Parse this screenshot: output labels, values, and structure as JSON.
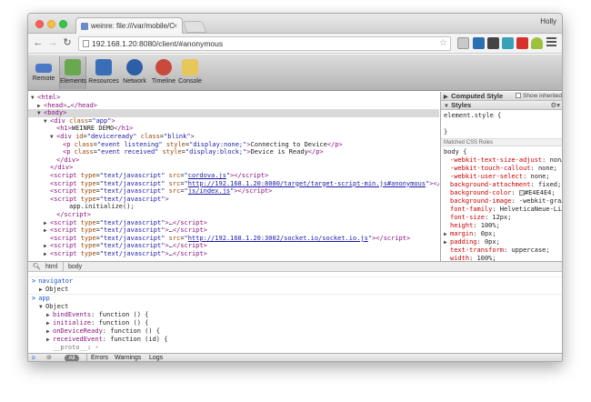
{
  "tab": {
    "title": "weinre: file:///var/mobile/C",
    "close": "×"
  },
  "profile": "Holly",
  "address": "192.168.1.20:8080/client/#anonymous",
  "devtools": {
    "tools": [
      {
        "label": "Remote",
        "color": "#4b79c8"
      },
      {
        "label": "Elements",
        "color": "#6aa84f"
      },
      {
        "label": "Resources",
        "color": "#e2a93b"
      },
      {
        "label": "Network",
        "color": "#3a6fb8"
      },
      {
        "label": "Timeline",
        "color": "#c94a3d"
      },
      {
        "label": "Console",
        "color": "#d88a2a"
      }
    ]
  },
  "elements": {
    "lines": [
      {
        "tri": "▼",
        "html": "<span class='tag'>&lt;html&gt;</span>",
        "indent": 0
      },
      {
        "tri": "▶",
        "html": "<span class='tag'>&lt;head&gt;</span>…<span class='tag'>&lt;/head&gt;</span>",
        "indent": 1
      },
      {
        "tri": "▼",
        "html": "<span class='tag'>&lt;body&gt;</span>",
        "indent": 1,
        "selected": true
      },
      {
        "tri": "▼",
        "html": "<span class='tag'>&lt;div </span><span class='attr'>class</span>=<span class='val'>\"app\"</span><span class='tag'>&gt;</span>",
        "indent": 2
      },
      {
        "tri": "",
        "html": "<span class='tag'>&lt;h1&gt;</span>WEINRE DEMO<span class='tag'>&lt;/h1&gt;</span>",
        "indent": 3
      },
      {
        "tri": "▼",
        "html": "<span class='tag'>&lt;div </span><span class='attr'>id</span>=<span class='val'>\"deviceready\"</span> <span class='attr'>class</span>=<span class='val'>\"blink\"</span><span class='tag'>&gt;</span>",
        "indent": 3
      },
      {
        "tri": "",
        "html": "<span class='tag'>&lt;p </span><span class='attr'>class</span>=<span class='val'>\"event listening\"</span> <span class='attr'>style</span>=<span class='val'>\"display:none;\"</span><span class='tag'>&gt;</span>Connecting to Device<span class='tag'>&lt;/p&gt;</span>",
        "indent": 4
      },
      {
        "tri": "",
        "html": "<span class='tag'>&lt;p </span><span class='attr'>class</span>=<span class='val'>\"event received\"</span> <span class='attr'>style</span>=<span class='val'>\"display:block;\"</span><span class='tag'>&gt;</span>Device is Ready<span class='tag'>&lt;/p&gt;</span>",
        "indent": 4
      },
      {
        "tri": "",
        "html": "<span class='tag'>&lt;/div&gt;</span>",
        "indent": 3
      },
      {
        "tri": "",
        "html": "<span class='tag'>&lt;/div&gt;</span>",
        "indent": 2
      },
      {
        "tri": "",
        "html": "<span class='tag'>&lt;script </span><span class='attr'>type</span>=<span class='val'>\"text/javascript\"</span> <span class='attr'>src</span>=<span class='val'>\"</span><span class='link'>cordova.js</span><span class='val'>\"</span><span class='tag'>&gt;&lt;/script&gt;</span>",
        "indent": 2
      },
      {
        "tri": "",
        "html": "<span class='tag'>&lt;script </span><span class='attr'>type</span>=<span class='val'>\"text/javascript\"</span> <span class='attr'>src</span>=<span class='val'>\"</span><span class='link'>http://192.168.1.20:8080/target/target-script-min.js#anonymous</span><span class='val'>\"</span><span class='tag'>&gt;&lt;/script&gt;</span>",
        "indent": 2
      },
      {
        "tri": "",
        "html": "<span class='tag'>&lt;script </span><span class='attr'>type</span>=<span class='val'>\"text/javascript\"</span> <span class='attr'>src</span>=<span class='val'>\"</span><span class='link'>js/index.js</span><span class='val'>\"</span><span class='tag'>&gt;&lt;/script&gt;</span>",
        "indent": 2
      },
      {
        "tri": "",
        "html": "<span class='tag'>&lt;script </span><span class='attr'>type</span>=<span class='val'>\"text/javascript\"</span><span class='tag'>&gt;</span>",
        "indent": 2
      },
      {
        "tri": "",
        "html": "<span class='txt'>app.initialize();</span>",
        "indent": 5
      },
      {
        "tri": "",
        "html": "<span class='tag'>&lt;/script&gt;</span>",
        "indent": 3
      },
      {
        "tri": "▶",
        "html": "<span class='tag'>&lt;script </span><span class='attr'>type</span>=<span class='val'>\"text/javascript\"</span><span class='tag'>&gt;</span>…<span class='tag'>&lt;/script&gt;</span>",
        "indent": 2
      },
      {
        "tri": "▶",
        "html": "<span class='tag'>&lt;script </span><span class='attr'>type</span>=<span class='val'>\"text/javascript\"</span><span class='tag'>&gt;</span>…<span class='tag'>&lt;/script&gt;</span>",
        "indent": 2
      },
      {
        "tri": "",
        "html": "<span class='tag'>&lt;script </span><span class='attr'>type</span>=<span class='val'>\"text/javascript\"</span> <span class='attr'>src</span>=<span class='val'>\"</span><span class='link'>http://192.168.1.20:3002/socket.io/socket.io.js</span><span class='val'>\"</span><span class='tag'>&gt;&lt;/script&gt;</span>",
        "indent": 2
      },
      {
        "tri": "▶",
        "html": "<span class='tag'>&lt;script </span><span class='attr'>type</span>=<span class='val'>\"text/javascript\"</span><span class='tag'>&gt;</span>…<span class='tag'>&lt;/script&gt;</span>",
        "indent": 2
      },
      {
        "tri": "▶",
        "html": "<span class='tag'>&lt;script </span><span class='attr'>type</span>=<span class='val'>\"text/javascript\"</span><span class='tag'>&gt;</span>…<span class='tag'>&lt;/script&gt;</span>",
        "indent": 2
      }
    ]
  },
  "sidebar": {
    "computed_title": "Computed Style",
    "show_inherited": "Show inherited",
    "styles_title": "Styles",
    "element_style": "element.style {",
    "close_brace": "}",
    "matched_title": "Matched CSS Rules",
    "body_selector": "body {",
    "props": [
      {
        "exp": false,
        "name": "-webkit-text-size-adjust",
        "value": "non…"
      },
      {
        "exp": false,
        "name": "-webkit-touch-callout",
        "value": "none;"
      },
      {
        "exp": false,
        "name": "-webkit-user-select",
        "value": "none;"
      },
      {
        "exp": false,
        "name": "background-attachment",
        "value": "fixed;"
      },
      {
        "exp": false,
        "name": "background-color",
        "value": "#E4E4E4;",
        "swatch": true
      },
      {
        "exp": false,
        "name": "background-image",
        "value": "-webkit-gra…"
      },
      {
        "exp": false,
        "name": "font-family",
        "value": "HelveticaNeue-Li…"
      },
      {
        "exp": false,
        "name": "font-size",
        "value": "12px;"
      },
      {
        "exp": false,
        "name": "height",
        "value": "100%;"
      },
      {
        "exp": true,
        "name": "margin",
        "value": "0px;"
      },
      {
        "exp": true,
        "name": "padding",
        "value": "0px;"
      },
      {
        "exp": false,
        "name": "text-transform",
        "value": "uppercase;"
      },
      {
        "exp": false,
        "name": "width",
        "value": "100%;"
      }
    ]
  },
  "breadcrumb": [
    "html",
    "body"
  ],
  "console": {
    "lines": [
      {
        "type": "input",
        "text": "navigator"
      },
      {
        "type": "obj",
        "tri": "▶",
        "text": "Object",
        "indent": 1
      },
      {
        "type": "input",
        "text": "app"
      },
      {
        "type": "obj",
        "tri": "▼",
        "text": "Object",
        "indent": 1
      },
      {
        "type": "fn",
        "tri": "▶",
        "name": "bindEvents",
        "value": "function () {",
        "indent": 2
      },
      {
        "type": "fn",
        "tri": "▶",
        "name": "initialize",
        "value": "function () {",
        "indent": 2
      },
      {
        "type": "fn",
        "tri": "▶",
        "name": "onDeviceReady",
        "value": "function () {",
        "indent": 2
      },
      {
        "type": "fn",
        "tri": "▶",
        "name": "receivedEvent",
        "value": "function (id) {",
        "indent": 2
      },
      {
        "type": "fn",
        "tri": "",
        "name": "__proto__",
        "value": "-",
        "indent": 2,
        "proto": true
      }
    ],
    "prompt": ">"
  },
  "status": {
    "all": "All",
    "filters": [
      "Errors",
      "Warnings",
      "Logs"
    ]
  }
}
